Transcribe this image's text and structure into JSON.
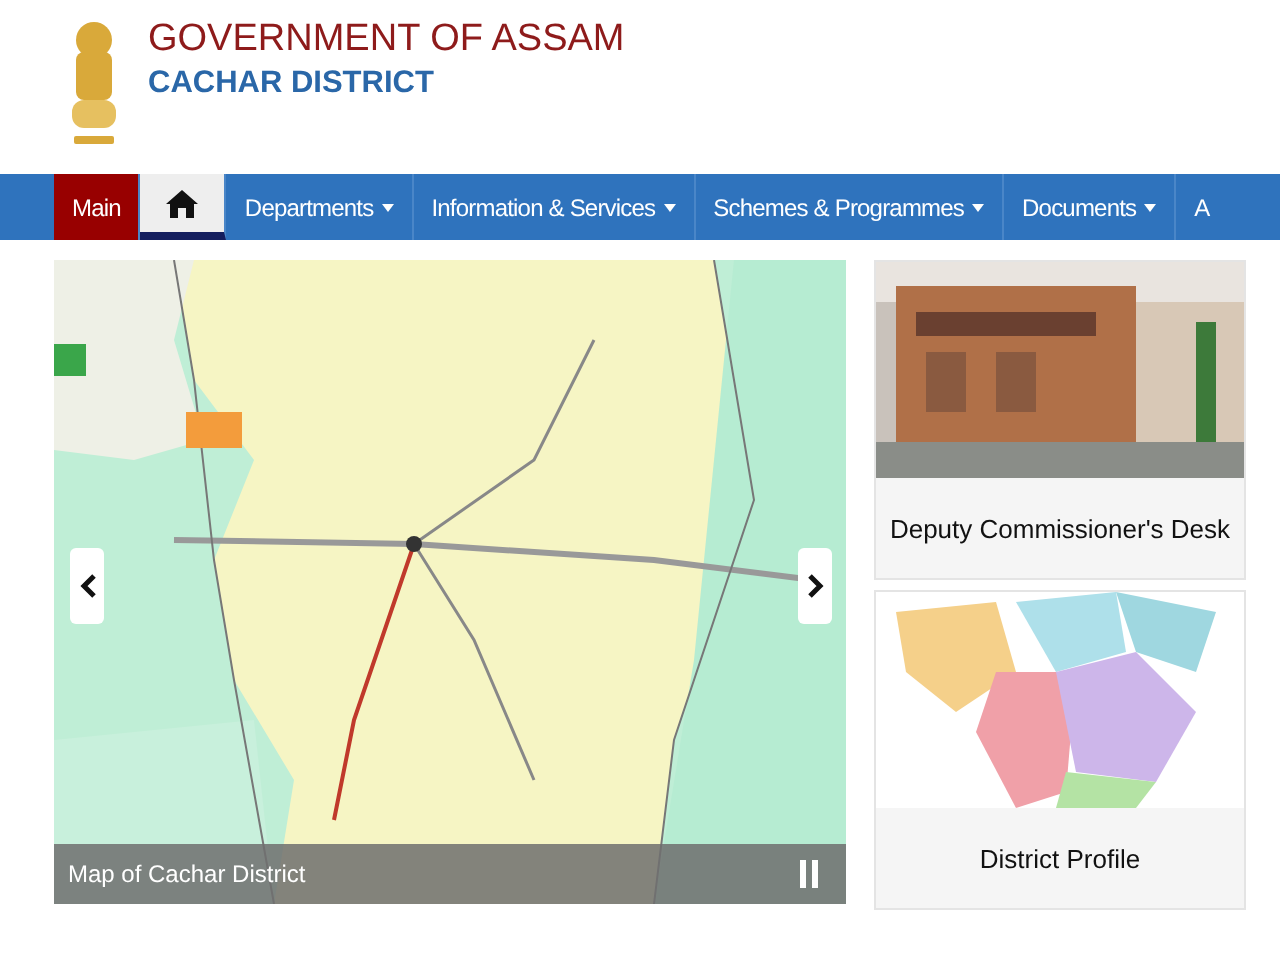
{
  "header": {
    "title": "GOVERNMENT OF ASSAM",
    "subtitle": "CACHAR DISTRICT"
  },
  "nav": [
    {
      "kind": "text",
      "label": "Main",
      "selected": true,
      "has_menu": false
    },
    {
      "kind": "home",
      "selected": true,
      "has_menu": false
    },
    {
      "kind": "text",
      "label": "Departments",
      "selected": false,
      "has_menu": true
    },
    {
      "kind": "text",
      "label": "Information & Services",
      "selected": false,
      "has_menu": true
    },
    {
      "kind": "text",
      "label": "Schemes & Programmes",
      "selected": false,
      "has_menu": true
    },
    {
      "kind": "text",
      "label": "Documents",
      "selected": false,
      "has_menu": true
    },
    {
      "kind": "text",
      "label": "A",
      "selected": false,
      "has_menu": false
    }
  ],
  "slideshow": {
    "caption": "Map of Cachar District"
  },
  "cards": [
    {
      "caption": "Deputy Commissioner's Desk"
    },
    {
      "kind": "map",
      "caption": "District Profile"
    }
  ]
}
